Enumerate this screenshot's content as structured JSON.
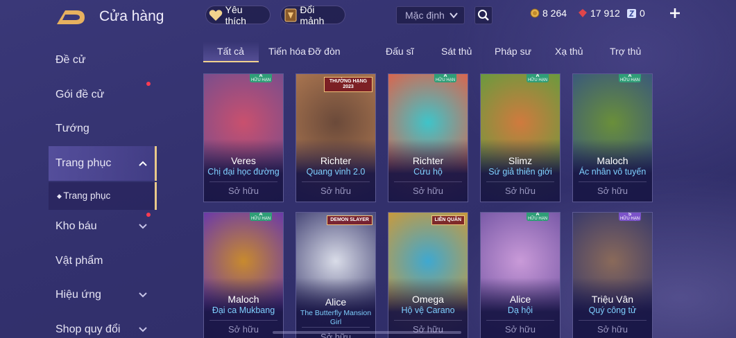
{
  "header": {
    "title": "Cửa hàng",
    "favorites_label": "Yêu thích",
    "exchange_label": "Đổi mảnh",
    "sort": {
      "selected": "Mặc định"
    },
    "currencies": [
      {
        "icon": "gold-coin-icon",
        "value": "8 264"
      },
      {
        "icon": "red-gem-icon",
        "value": "17 912"
      },
      {
        "icon": "voucher-icon",
        "value": "0"
      }
    ]
  },
  "sidebar": {
    "items": [
      {
        "label": "Đề cử"
      },
      {
        "label": "Gói đề cử"
      },
      {
        "label": "Tướng"
      },
      {
        "label": "Trang phục"
      },
      {
        "label": "Trang phục"
      },
      {
        "label": "Kho báu"
      },
      {
        "label": "Vật phẩm"
      },
      {
        "label": "Hiệu ứng"
      },
      {
        "label": "Shop quy đổi"
      }
    ]
  },
  "tabs": [
    "Tất cả",
    "Tiến hóa",
    "Đỡ đòn",
    "Đấu sĩ",
    "Sát thủ",
    "Pháp sư",
    "Xạ thủ",
    "Trợ thủ"
  ],
  "active_tab": "Tất cả",
  "cards": [
    {
      "hero": "Veres",
      "skin": "Chị đại học đường",
      "status": "Sở hữu",
      "badge_rank": "A",
      "badge_text": "HỮU HẠN",
      "colors": [
        "#c9506e",
        "#7b4d8c"
      ]
    },
    {
      "hero": "Richter",
      "skin": "Quang vinh 2.0",
      "status": "Sở hữu",
      "banner": "THƯỜNG HẠNG 2023",
      "colors": [
        "#6b4a3a",
        "#a8744f"
      ]
    },
    {
      "hero": "Richter",
      "skin": "Cứu hộ",
      "status": "Sở hữu",
      "badge_rank": "A",
      "badge_text": "HỮU HẠN",
      "colors": [
        "#3fc4c9",
        "#d8664f"
      ]
    },
    {
      "hero": "Slimz",
      "skin": "Sứ giả thiên giới",
      "status": "Sở hữu",
      "badge_rank": "A",
      "badge_text": "HỮU HẠN",
      "colors": [
        "#d07a3e",
        "#6a9a3e"
      ]
    },
    {
      "hero": "Maloch",
      "skin": "Ác nhân vô tuyến",
      "status": "Sở hữu",
      "badge_rank": "A",
      "badge_text": "HỮU HẠN",
      "colors": [
        "#6a8f3a",
        "#3a5a7a"
      ]
    },
    {
      "hero": "Maloch",
      "skin": "Đại ca Mukbang",
      "status": "Sở hữu",
      "badge_rank": "A",
      "badge_text": "HỮU HẠN",
      "colors": [
        "#c88a2e",
        "#6b3aa8"
      ]
    },
    {
      "hero": "Alice",
      "skin": "The Butterfly Mansion Girl",
      "status": "Sở hữu",
      "banner": "DEMON SLAYER",
      "colors": [
        "#d9dce8",
        "#4a4a7a"
      ]
    },
    {
      "hero": "Omega",
      "skin": "Hộ vệ Carano",
      "status": "Sở hữu",
      "banner": "LIÊN QUÂN",
      "colors": [
        "#3fa8d0",
        "#c89a3e"
      ]
    },
    {
      "hero": "Alice",
      "skin": "Dạ hội",
      "status": "Sở hữu",
      "badge_rank": "A",
      "badge_text": "HỮU HẠN",
      "colors": [
        "#c99ad8",
        "#7a5aa8"
      ]
    },
    {
      "hero": "Triệu Vân",
      "skin": "Quý công tử",
      "status": "Sở hữu",
      "badge_rank": "S",
      "badge_text": "HỮU HẠN",
      "colors": [
        "#8a6a5a",
        "#3a3a6a"
      ]
    }
  ],
  "colors": {
    "accent_gold": "#f3d38f",
    "skin_name": "#7fd0ff",
    "notification": "#ff3b52"
  }
}
